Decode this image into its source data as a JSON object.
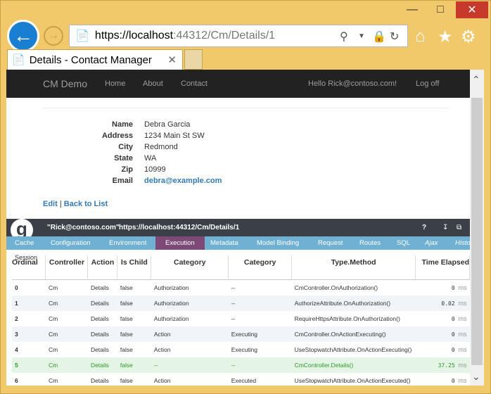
{
  "browser": {
    "url_host": "https://localhost",
    "url_rest": ":44312/Cm/Details/1",
    "tab_title": "Details - Contact Manager"
  },
  "nav": {
    "brand": "CM Demo",
    "items": [
      "Home",
      "About",
      "Contact"
    ],
    "greeting": "Hello Rick@contoso.com!",
    "logoff": "Log off"
  },
  "details": [
    {
      "label": "Name",
      "value": "Debra Garcia"
    },
    {
      "label": "Address",
      "value": "1234 Main St SW"
    },
    {
      "label": "City",
      "value": "Redmond"
    },
    {
      "label": "State",
      "value": "WA"
    },
    {
      "label": "Zip",
      "value": "10999"
    },
    {
      "label": "Email",
      "value": "debra@example.com"
    }
  ],
  "links": {
    "edit": "Edit",
    "sep": "|",
    "back": "Back to List"
  },
  "glimpse": {
    "user": "\"Rick@contoso.com\"",
    "url": "https://localhost:44312/Cm/Details/1",
    "help": "?",
    "tabs": [
      "Cache",
      "Configuration",
      "Environment",
      "Execution",
      "Metadata",
      "Model Binding",
      "Request",
      "Routes",
      "SQL",
      "Ajax",
      "Histo"
    ],
    "session": "Session",
    "columns": [
      "Ordinal",
      "Controller",
      "Action",
      "Is Child",
      "Category",
      "Category",
      "Type.Method",
      "Time Elapsed"
    ],
    "rows": [
      [
        "0",
        "Cm",
        "Details",
        "false",
        "Authorization",
        "--",
        "CmController.OnAuthorization()",
        "0"
      ],
      [
        "1",
        "Cm",
        "Details",
        "false",
        "Authorization",
        "--",
        "AuthorizeAttribute.OnAuthorization()",
        "0.02"
      ],
      [
        "2",
        "Cm",
        "Details",
        "false",
        "Authorization",
        "--",
        "RequireHttpsAttribute.OnAuthorization()",
        "0"
      ],
      [
        "3",
        "Cm",
        "Details",
        "false",
        "Action",
        "Executing",
        "CmController.OnActionExecuting()",
        "0"
      ],
      [
        "4",
        "Cm",
        "Details",
        "false",
        "Action",
        "Executing",
        "UseStopwatchAttribute.OnActionExecuting()",
        "0"
      ],
      [
        "5",
        "Cm",
        "Details",
        "false",
        "--",
        "--",
        "CmController.Details()",
        "37.25"
      ],
      [
        "6",
        "Cm",
        "Details",
        "false",
        "Action",
        "Executed",
        "UseStopwatchAttribute.OnActionExecuted()",
        "0"
      ]
    ],
    "unit": "ms"
  }
}
